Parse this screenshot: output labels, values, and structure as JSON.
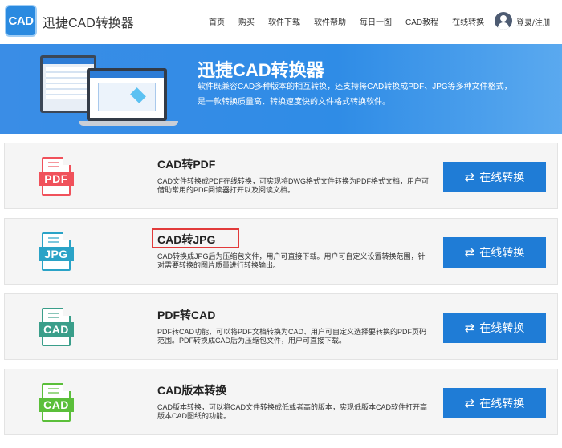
{
  "header": {
    "logo_text": "CAD",
    "brand": "迅捷CAD转换器",
    "nav": [
      "首页",
      "购买",
      "软件下载",
      "软件帮助",
      "每日一图",
      "CAD教程",
      "在线转换"
    ],
    "login": "登录/注册"
  },
  "banner": {
    "title": "迅捷CAD转换器",
    "description": "软件既兼容CAD多种版本的相互转换，还支持将CAD转换成PDF、JPG等多种文件格式，是一款转换质量高、转换速度快的文件格式转换软件。"
  },
  "cards": [
    {
      "icon_label": "PDF",
      "icon_color": "#f0515b",
      "title": "CAD转PDF",
      "description": "CAD文件转换成PDF在线转换，可实现将DWG格式文件转换为PDF格式文档，用户可借助常用的PDF阅读器打开以及阅读文档。",
      "button": "在线转换"
    },
    {
      "icon_label": "JPG",
      "icon_color": "#2aa3c7",
      "title": "CAD转JPG",
      "description": "CAD转换成JPG后为压缩包文件，用户可直接下载。用户可自定义设置转换范围，针对需要转换的图片质量进行转换输出。",
      "button": "在线转换"
    },
    {
      "icon_label": "CAD",
      "icon_color": "#3a9e8a",
      "title": "PDF转CAD",
      "description": "PDF转CAD功能，可以将PDF文档转换为CAD、用户可自定义选择要转换的PDF页码范围。PDF转换成CAD后为压缩包文件，用户可直接下载。",
      "button": "在线转换"
    },
    {
      "icon_label": "CAD",
      "icon_color": "#5bbf3a",
      "title": "CAD版本转换",
      "description": "CAD版本转换，可以将CAD文件转换成低或者高的版本，实现低版本CAD软件打开高版本CAD图纸的功能。",
      "button": "在线转换"
    }
  ],
  "colors": {
    "banner_blue": "#3a8de6",
    "button_blue": "#1f7cd6",
    "highlight_red": "#e23a3a"
  }
}
